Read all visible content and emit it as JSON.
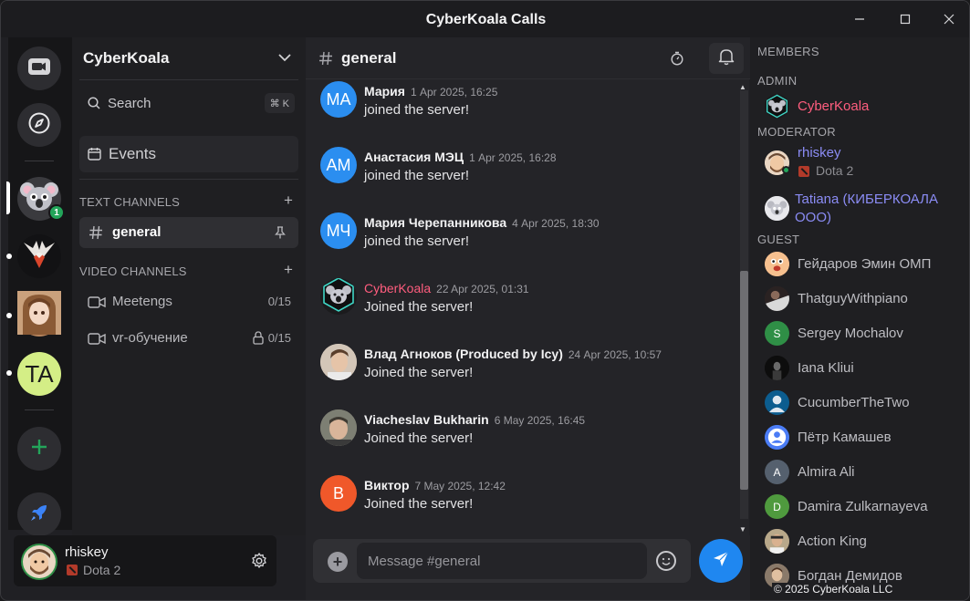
{
  "window": {
    "title": "CyberKoala Calls",
    "controls": [
      "minimize-icon",
      "maximize-icon",
      "close-icon"
    ]
  },
  "rail": {
    "items": [
      {
        "name": "video-calls",
        "icon": "video-camera-icon"
      },
      {
        "name": "explore",
        "icon": "compass-icon"
      },
      {
        "name": "server-cyberkoala",
        "icon": "koala-icon",
        "badge": "1",
        "selected": true
      },
      {
        "name": "server-eagle",
        "icon": "eagle-icon"
      },
      {
        "name": "server-anime",
        "icon": "anime-avatar-icon"
      },
      {
        "name": "server-ta",
        "initials": "TA",
        "color": "#d4ee86"
      },
      {
        "name": "add-server",
        "icon": "plus-icon"
      },
      {
        "name": "boost",
        "icon": "rocket-icon"
      }
    ]
  },
  "sidebar": {
    "server_name": "CyberKoala",
    "search_label": "Search",
    "search_shortcut": "⌘ K",
    "events_label": "Events",
    "text_category": "TEXT CHANNELS",
    "video_category": "VIDEO CHANNELS",
    "text_channels": [
      {
        "name": "general",
        "active": true
      }
    ],
    "video_channels": [
      {
        "name": "Meetengs",
        "count": "0/15",
        "locked": false
      },
      {
        "name": "vr-обучение",
        "count": "0/15",
        "locked": true
      }
    ]
  },
  "user_panel": {
    "name": "rhiskey",
    "status": "Dota 2"
  },
  "chat": {
    "channel": "general",
    "messages": [
      {
        "author": "Мария",
        "time": "1 Apr 2025, 16:25",
        "text": "joined the server!",
        "initials": "МА",
        "color": "#2b8ef0"
      },
      {
        "author": "Анастасия МЭЦ",
        "time": "1 Apr 2025, 16:28",
        "text": "joined the server!",
        "initials": "АМ",
        "color": "#2b8ef0"
      },
      {
        "author": "Мария Черепанникова",
        "time": "4 Apr 2025, 18:30",
        "text": "joined the server!",
        "initials": "МЧ",
        "color": "#2b8ef0"
      },
      {
        "author": "CyberKoala",
        "time": "22 Apr 2025, 01:31",
        "text": "Joined the server!",
        "initials": "",
        "color": "#1b1b1d",
        "pink": true
      },
      {
        "author": "Влад Агноков (Produced by Icy)",
        "time": "24 Apr 2025, 10:57",
        "text": "Joined the server!",
        "initials": "",
        "color": "#c9b9a6"
      },
      {
        "author": "Viacheslav Bukharin",
        "time": "6 May 2025, 16:45",
        "text": "Joined the server!",
        "initials": "",
        "color": "#8a8a7a"
      },
      {
        "author": "Виктор",
        "time": "7 May 2025, 12:42",
        "text": "Joined the server!",
        "initials": "В",
        "color": "#f0582a"
      }
    ],
    "composer_placeholder": "Message #general"
  },
  "members": {
    "title": "MEMBERS",
    "groups": [
      {
        "label": "ADMIN",
        "items": [
          {
            "name": "CyberKoala",
            "color": "#ff5d7e",
            "avatar": "koala",
            "initials": ""
          }
        ]
      },
      {
        "label": "MODERATOR",
        "items": [
          {
            "name": "rhiskey",
            "status": "Dota 2",
            "color": "#8b8cf5",
            "avatar": "photo",
            "initials": "",
            "online": true
          },
          {
            "name": "Tatiana (КИБЕРКОАЛА ООО)",
            "color": "#8b8cf5",
            "avatar": "koala-light",
            "initials": ""
          }
        ]
      },
      {
        "label": "GUEST",
        "items": [
          {
            "name": "Гейдаров Эмин ОМП",
            "avatar": "emoji",
            "initials": ""
          },
          {
            "name": "ThatguyWithpiano",
            "avatar": "photo-dark",
            "initials": ""
          },
          {
            "name": "Sergey Mochalov",
            "avatar": "initial",
            "initials": "S",
            "bg": "#2f8f46"
          },
          {
            "name": "Iana Kliui",
            "avatar": "photo-dark",
            "initials": ""
          },
          {
            "name": "CucumberTheTwo",
            "avatar": "photo-blue",
            "initials": ""
          },
          {
            "name": "Пётр Камашев",
            "avatar": "default-user",
            "initials": ""
          },
          {
            "name": "Almira Ali",
            "avatar": "initial",
            "initials": "A",
            "bg": "#55606e"
          },
          {
            "name": "Damira Zulkarnayeva",
            "avatar": "initial",
            "initials": "D",
            "bg": "#4f9a3e"
          },
          {
            "name": "Action King",
            "avatar": "photo",
            "initials": ""
          },
          {
            "name": "Богдан Демидов",
            "avatar": "photo",
            "initials": ""
          }
        ]
      }
    ]
  },
  "footer": {
    "copyright": "© 2025 CyberKoala  LLC"
  }
}
